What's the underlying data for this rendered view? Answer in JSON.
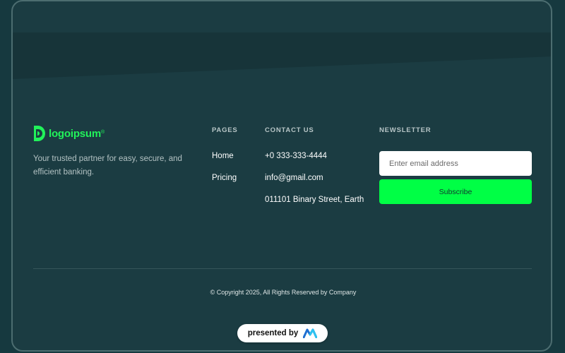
{
  "brand": {
    "name": "logoipsum",
    "trademark": "®",
    "tagline": "Your trusted partner for easy, secure, and efficient banking.",
    "color": "#21f25a",
    "logo_icon": "logoipsum-mark-icon"
  },
  "pages": {
    "heading": "PAGES",
    "links": [
      {
        "label": "Home"
      },
      {
        "label": "Pricing"
      }
    ]
  },
  "contact": {
    "heading": "CONTACT US",
    "phone": "+0 333-333-4444",
    "email": "info@gmail.com",
    "address": "011101 Binary Street, Earth"
  },
  "newsletter": {
    "heading": "NEWSLETTER",
    "email_placeholder": "Enter email address",
    "email_value": "",
    "subscribe_label": "Subscribe",
    "button_color": "#00ff45"
  },
  "footer": {
    "copyright": "© Copyright 2025, All Rights Reserved by Company"
  },
  "badge": {
    "label": "presented by",
    "logo_icon": "m-logo-icon"
  },
  "colors": {
    "background": "#1b3c42",
    "outer_background": "#16393f",
    "band": "#173439",
    "border": "#4c6d70"
  }
}
